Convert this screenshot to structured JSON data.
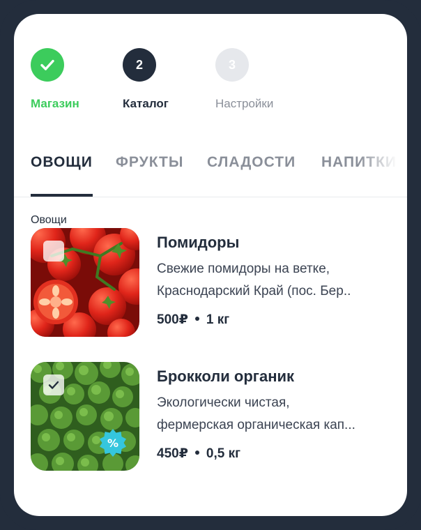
{
  "stepper": {
    "steps": [
      {
        "number": "",
        "label": "Магазин",
        "state": "done"
      },
      {
        "number": "2",
        "label": "Каталог",
        "state": "active"
      },
      {
        "number": "3",
        "label": "Настройки",
        "state": "todo"
      }
    ]
  },
  "tabs": [
    {
      "label": "ОВОЩИ",
      "active": true
    },
    {
      "label": "ФРУКТЫ",
      "active": false
    },
    {
      "label": "СЛАДОСТИ",
      "active": false
    },
    {
      "label": "НАПИТКИ",
      "active": false
    }
  ],
  "section": {
    "title": "Овощи"
  },
  "products": [
    {
      "name": "Помидоры",
      "desc_line1": "Свежие помидоры на ветке,",
      "desc_line2": "Краснодарский Край (пос. Бер..",
      "price": "500₽",
      "weight": "1 кг",
      "checked": false,
      "discount": false,
      "image": "tomatoes"
    },
    {
      "name": "Брокколи органик",
      "desc_line1": "Экологически чистая,",
      "desc_line2": "фермерская органическая кап...",
      "price": "450₽",
      "weight": "0,5 кг",
      "checked": true,
      "discount": true,
      "discount_symbol": "%",
      "image": "broccoli"
    }
  ],
  "colors": {
    "dark": "#232d3c",
    "green": "#3ccc5c",
    "muted": "#8a8f99",
    "discount": "#35c6dd"
  },
  "icons": {
    "done_step": "check-icon",
    "checkbox_checked": "check-icon",
    "discount": "discount-badge-icon"
  }
}
